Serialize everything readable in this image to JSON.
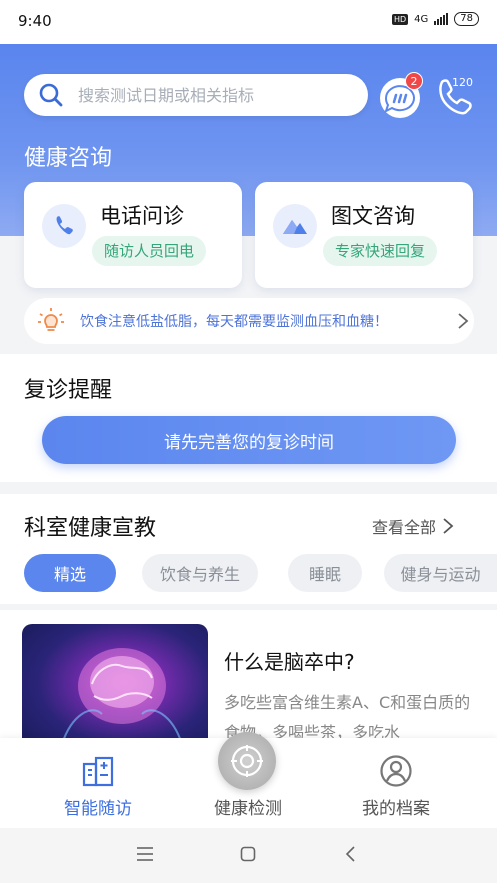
{
  "status_bar": {
    "time": "9:40",
    "network": "4G",
    "hd": "HD",
    "battery": "78"
  },
  "header": {
    "search_placeholder": "搜索测试日期或相关指标",
    "message_badge": "2",
    "hotline": "120",
    "section_title": "健康咨询"
  },
  "consult_cards": [
    {
      "title": "电话问诊",
      "subtitle": "随访人员回电",
      "icon": "phone-icon"
    },
    {
      "title": "图文咨询",
      "subtitle": "专家快速回复",
      "icon": "mountain-image-icon"
    }
  ],
  "tip": {
    "text": "饮食注意低盐低脂，每天都需要监测血压和血糖！",
    "icon": "lightbulb-icon"
  },
  "revisit": {
    "title": "复诊提醒",
    "button": "请先完善您的复诊时间"
  },
  "education": {
    "title": "科室健康宣教",
    "view_all": "查看全部",
    "chips": [
      {
        "label": "精选",
        "active": true
      },
      {
        "label": "饮食与养生",
        "active": false
      },
      {
        "label": "睡眠",
        "active": false
      },
      {
        "label": "健身与运动",
        "active": false
      }
    ],
    "article": {
      "title": "什么是脑卒中?",
      "description": "多吃些富含维生素A、C和蛋白质的食物，多喝些茶，多吃水"
    }
  },
  "bottom_nav": [
    {
      "label": "智能随访",
      "icon": "hospital-icon",
      "active": true
    },
    {
      "label": "健康检测",
      "icon": "detect-icon",
      "active": false
    },
    {
      "label": "我的档案",
      "icon": "profile-icon",
      "active": false
    }
  ],
  "colors": {
    "primary": "#5b86ee",
    "green": "#35a57a",
    "badge": "#f04848"
  }
}
